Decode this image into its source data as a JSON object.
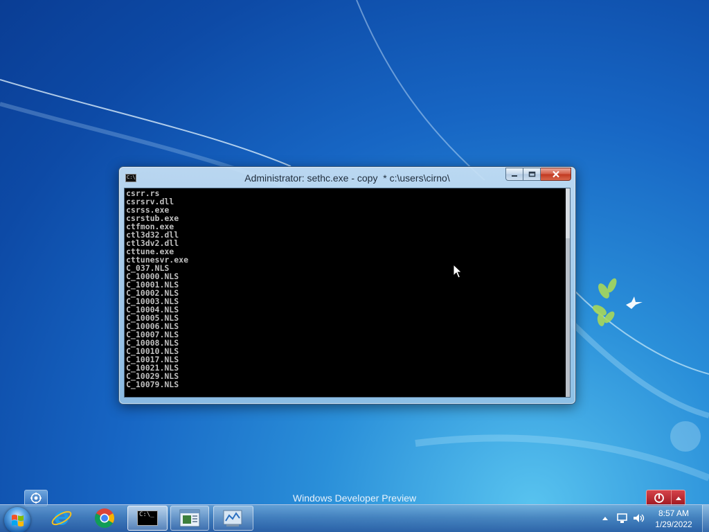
{
  "desktop": {
    "watermark": "Windows Developer Preview"
  },
  "console_window": {
    "title": "Administrator: sethc.exe - copy  * c:\\users\\cirno\\",
    "lines": [
      "csrr.rs",
      "csrsrv.dll",
      "csrss.exe",
      "csrstub.exe",
      "ctfmon.exe",
      "ctl3d32.dll",
      "ctl3dv2.dll",
      "cttune.exe",
      "cttunesvr.exe",
      "C_037.NLS",
      "C_10000.NLS",
      "C_10001.NLS",
      "C_10002.NLS",
      "C_10003.NLS",
      "C_10004.NLS",
      "C_10005.NLS",
      "C_10006.NLS",
      "C_10007.NLS",
      "C_10008.NLS",
      "C_10010.NLS",
      "C_10017.NLS",
      "C_10021.NLS",
      "C_10029.NLS",
      "C_10079.NLS"
    ],
    "icon_label": "C:\\",
    "buttons": [
      "minimize-icon",
      "maximize-icon",
      "close-icon"
    ]
  },
  "taskbar": {
    "pinned": [
      {
        "name": "start-orb",
        "icon": "windows-logo-icon"
      },
      {
        "name": "internet-explorer",
        "icon": "internet-explorer-icon"
      },
      {
        "name": "google-chrome",
        "icon": "chrome-icon"
      },
      {
        "name": "command-prompt",
        "icon": "cmd-icon",
        "icon_label": "C:\\_"
      },
      {
        "name": "explorer-window",
        "icon": "window-icon"
      },
      {
        "name": "control-panel",
        "icon": "control-panel-icon"
      }
    ],
    "tray": {
      "icons": [
        "show-hidden-icons",
        "network-icon",
        "volume-icon"
      ],
      "time": "8:57 AM",
      "date": "1/29/2022"
    }
  },
  "colors": {
    "console_bg": "#000000",
    "console_text": "#c0c0c0",
    "close_button": "#c8402a",
    "desktop_blue": "#1766c4"
  }
}
